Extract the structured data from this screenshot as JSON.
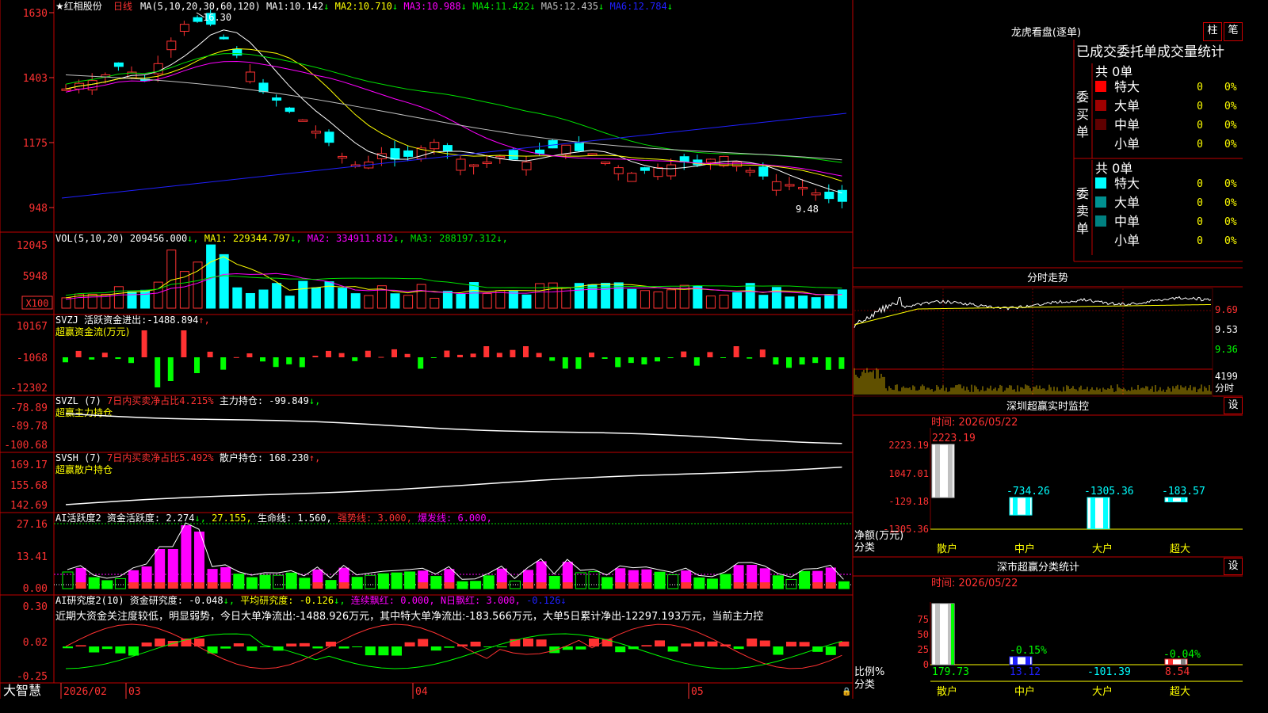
{
  "colors": {
    "up": "#ff3232",
    "down": "#00ffff",
    "border": "#c00000",
    "axis_text": "#ff3232",
    "white": "#ffffff",
    "yellow": "#ffff00",
    "magenta": "#ff00ff",
    "green": "#00e000",
    "blue": "#2020ff",
    "gray": "#c0c0c0",
    "lime": "#00ff00"
  },
  "header": {
    "star": "★",
    "stock_name": "红相股份",
    "period": "日线",
    "ma_title": "MA(5,10,20,30,60,120)",
    "ma_values": [
      {
        "label": "MA1:",
        "value": "10.142",
        "arrow": "↓",
        "color": "#ffffff"
      },
      {
        "label": "MA2:",
        "value": "10.710",
        "arrow": "↓",
        "color": "#ffff00"
      },
      {
        "label": "MA3:",
        "value": "10.988",
        "arrow": "↓",
        "color": "#ff00ff"
      },
      {
        "label": "MA4:",
        "value": "11.422",
        "arrow": "↓",
        "color": "#00e000"
      },
      {
        "label": "MA5:",
        "value": "12.435",
        "arrow": "↓",
        "color": "#c0c0c0"
      },
      {
        "label": "MA6:",
        "value": "12.784",
        "arrow": "↓",
        "color": "#2020ff"
      }
    ]
  },
  "price_axis": {
    "ticks": [
      "1630",
      "1403",
      "1175",
      "948"
    ],
    "high_label": "16.30",
    "low_label": "9.48"
  },
  "vol_panel": {
    "title": "VOL(5,10,20)",
    "value": "209456.000",
    "arrow": "↓",
    "ma": [
      {
        "label": "MA1:",
        "value": "229344.797",
        "arrow": "↓",
        "color": "#ffff00"
      },
      {
        "label": "MA2:",
        "value": "334911.812",
        "arrow": "↓",
        "color": "#ff00ff"
      },
      {
        "label": "MA3:",
        "value": "288197.312",
        "arrow": "↓",
        "color": "#00e000"
      }
    ],
    "ticks": [
      "12045",
      "5948"
    ],
    "unit": "X100"
  },
  "svzj_panel": {
    "title": "SVZJ",
    "label": "活跃资金进出:",
    "value": "-1488.894",
    "arrow": "↑,",
    "sub": "超赢资金流(万元)",
    "ticks": [
      "10167",
      "-1068",
      "-12302"
    ]
  },
  "svzl_panel": {
    "title": "SVZL (7)",
    "label1": "7日内买卖净占比4.215%",
    "label2": "主力持仓:",
    "value": "-99.849",
    "arrow": "↓,",
    "sub": "超赢主力持仓",
    "ticks": [
      "-78.89",
      "-89.78",
      "-100.68"
    ]
  },
  "svsh_panel": {
    "title": "SVSH (7)",
    "label1": "7日内买卖净占比5.492%",
    "label2": "散户持仓:",
    "value": "168.230",
    "arrow": "↑,",
    "sub": "超赢散户持仓",
    "ticks": [
      "169.17",
      "155.68",
      "142.69"
    ]
  },
  "ai_active_panel": {
    "title": "AI活跃度2",
    "l1": "资金活跃度:",
    "v1": "2.274",
    "a1": "↓,",
    "v2": "27.155,",
    "l3": "生命线:",
    "v3": "1.560,",
    "l4": "强势线:",
    "v4": "3.000,",
    "l5": "爆发线:",
    "v5": "6.000,",
    "ticks": [
      "27.16",
      "13.41",
      "0.00"
    ]
  },
  "ai_research_panel": {
    "title": "AI研究度2(10)",
    "l1": "资金研究度:",
    "v1": "-0.048",
    "a1": "↓,",
    "l2": "平均研究度:",
    "v2": "-0.126",
    "a2": "↓,",
    "l3": "连续飘红:",
    "v3": "0.000,",
    "l4": "N日飘红:",
    "v4": "3.000,",
    "v5": "-0.126",
    "a5": "↓",
    "desc": "近期大资金关注度较低，明显弱势，今日大单净流出:-1488.926万元，其中特大单净流出:-183.566万元，大单5日累计净出-12297.193万元，当前主力控",
    "ticks": [
      "0.30",
      "0.02",
      "-0.25"
    ]
  },
  "date_axis": {
    "brand": "大智慧",
    "labels": [
      "2026/02",
      "03",
      "04",
      "05"
    ]
  },
  "lhb": {
    "title": "龙虎看盘(逐单)",
    "btn1": "柱",
    "btn2": "笔",
    "subtitle": "已成交委托单成交量统计",
    "buy": {
      "side": "委买单",
      "total": "共 0单",
      "rows": [
        {
          "name": "特大",
          "count": "0",
          "pct": "0%",
          "color": "#ff0000"
        },
        {
          "name": "大单",
          "count": "0",
          "pct": "0%",
          "color": "#a00000"
        },
        {
          "name": "中单",
          "count": "0",
          "pct": "0%",
          "color": "#600000"
        },
        {
          "name": "小单",
          "count": "0",
          "pct": "0%",
          "color": ""
        }
      ]
    },
    "sell": {
      "side": "委卖单",
      "total": "共 0单",
      "rows": [
        {
          "name": "特大",
          "count": "0",
          "pct": "0%",
          "color": "#00ffff"
        },
        {
          "name": "大单",
          "count": "0",
          "pct": "0%",
          "color": "#009090"
        },
        {
          "name": "中单",
          "count": "0",
          "pct": "0%",
          "color": "#008080"
        },
        {
          "name": "小单",
          "count": "0",
          "pct": "0%",
          "color": ""
        }
      ]
    }
  },
  "intraday": {
    "title": "分时走势",
    "price_ticks": [
      "9.69",
      "9.53",
      "9.36"
    ],
    "vol_tick": "4199",
    "vol_unit": "分时"
  },
  "sz_monitor": {
    "title": "深圳超赢实时监控",
    "btn": "设",
    "time": "时间: 2026/05/22",
    "ticks": [
      "2223.19",
      "1047.01",
      "-129.18",
      "-1305.36"
    ],
    "y_label": "净额(万元)",
    "x_label": "分类",
    "cats": [
      "散户",
      "中户",
      "大户",
      "超大"
    ],
    "values": [
      2223.19,
      -734.26,
      -1305.36,
      -183.57
    ],
    "value_labels": [
      "2223.19",
      "-734.26",
      "-1305.36",
      "-183.57"
    ]
  },
  "sz_class": {
    "title": "深市超赢分类统计",
    "btn": "设",
    "time": "时间: 2026/05/22",
    "ticks": [
      "75",
      "50",
      "25",
      "0"
    ],
    "y_label": "比例%",
    "x_label": "分类",
    "cats": [
      "散户",
      "中户",
      "大户",
      "超大"
    ],
    "pcts": [
      100,
      0.15,
      0,
      0.04
    ],
    "pct_labels": [
      "",
      "-0.15%",
      "",
      "-0.04%"
    ],
    "values": [
      "179.73",
      "13.12",
      "-101.39",
      "8.54"
    ]
  }
}
